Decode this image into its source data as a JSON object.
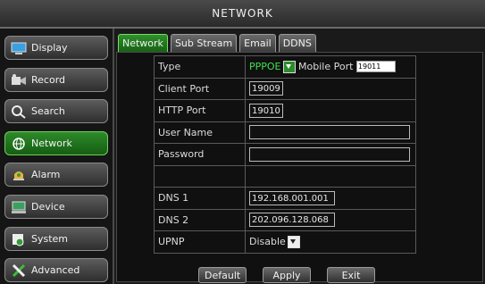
{
  "window": {
    "title": "NETWORK"
  },
  "sidebar": {
    "items": [
      {
        "label": "Display",
        "icon": "monitor-icon"
      },
      {
        "label": "Record",
        "icon": "record-icon"
      },
      {
        "label": "Search",
        "icon": "search-icon"
      },
      {
        "label": "Network",
        "icon": "network-icon",
        "active": true
      },
      {
        "label": "Alarm",
        "icon": "alarm-icon"
      },
      {
        "label": "Device",
        "icon": "device-icon"
      },
      {
        "label": "System",
        "icon": "system-icon"
      },
      {
        "label": "Advanced",
        "icon": "tools-icon"
      }
    ]
  },
  "tabs": [
    {
      "label": "Network",
      "active": true
    },
    {
      "label": "Sub Stream"
    },
    {
      "label": "Email"
    },
    {
      "label": "DDNS"
    }
  ],
  "form": {
    "type_label": "Type",
    "type_value": "PPPOE",
    "mobile_port_label": "Mobile Port",
    "mobile_port_value": "19011",
    "client_port_label": "Client Port",
    "client_port_value": "19009",
    "http_port_label": "HTTP Port",
    "http_port_value": "19010",
    "user_name_label": "User Name",
    "user_name_value": "",
    "password_label": "Password",
    "password_value": "",
    "dns1_label": "DNS 1",
    "dns1_value": "192.168.001.001",
    "dns2_label": "DNS 2",
    "dns2_value": "202.096.128.068",
    "upnp_label": "UPNP",
    "upnp_value": "Disable"
  },
  "buttons": {
    "default": "Default",
    "apply": "Apply",
    "exit": "Exit"
  },
  "colors": {
    "accent_green": "#2f8f2b",
    "text_green": "#3fe04f"
  }
}
